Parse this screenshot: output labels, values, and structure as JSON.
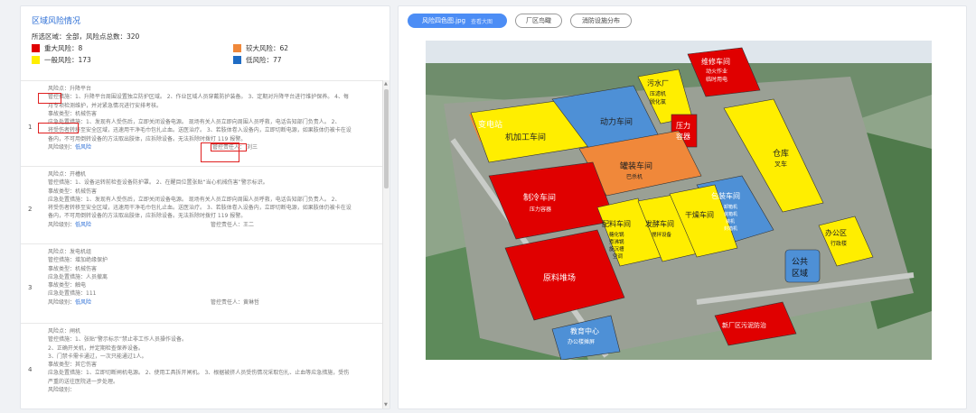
{
  "left_panel": {
    "title": "区域风险情况",
    "summary": "所选区域：全部，风险点总数：320",
    "legend": [
      {
        "label": "重大风险：8",
        "color": "#e00000"
      },
      {
        "label": "较大风险：62",
        "color": "#f0883a"
      },
      {
        "label": "一般风险：173",
        "color": "#ffee00"
      },
      {
        "label": "低风险：77",
        "color": "#1f6cc4"
      }
    ],
    "rows": [
      {
        "index": "1",
        "lines": [
          "风险点：升降平台",
          "管控措施：1、升降平台周围设置独立防护区域。 2、作业区域人员穿戴防护装备。 3、定期对升降平台进行维护保养。 4、每",
          "月专项检测维护，并对紧急情况进行安排考核。",
          "事故类型：机械伤害",
          "应急处置措施：1、发现有人受伤后，立即关闭设备电源。 现场有关人员立即向周围人员呼救，电话告知部门负责人。 2、",
          "将受伤者转移至安全区域，迅速用干净毛巾包扎止血。送医治疗。 3、若肢体卷入设备内，立即切断电源，如果肢体仍被卡在设",
          "备内，不可用倒转设备的方法取出肢体，应拆除设备。无法拆除时拨打 119 报警。"
        ],
        "level_label": "风险级别：",
        "level": "低风险",
        "owner_label": "管控责任人：",
        "owner": "刘三"
      },
      {
        "index": "2",
        "lines": [
          "风险点：开槽机",
          "管控措施：1、设备运转前检查设备防护罩。 2、在醒目位置张贴“当心机械伤害”警示标识。",
          "事故类型：机械伤害",
          "应急处置措施：1、发现有人受伤后，立即关闭设备电源。 现场有关人员立即向周围人员呼救，电话告知部门负责人。 2、",
          "将受伤者转移至安全区域，迅速用干净毛巾包扎止血。送医治疗。 3、若肢体卷入设备内，立即切断电源，如果肢体仍被卡在设",
          "备内，不可用倒转设备的方法取出肢体，应拆除设备。无法拆除时拨打 119 报警。"
        ],
        "level_label": "风险级别：",
        "level": "低风险",
        "owner_label": "管控责任人：",
        "owner": "王二"
      },
      {
        "index": "3",
        "lines": [
          "风险点：发电机组",
          "管控措施：增加绝缘保护",
          "事故类型：机械伤害",
          "应急处置措施：人员撤离",
          "事故类型：触电",
          "应急处置措施：111"
        ],
        "level_label": "风险级别：",
        "level": "低风险",
        "owner_label": "管控责任人：",
        "owner": "黄琳哲"
      },
      {
        "index": "4",
        "lines": [
          "风险点：闸机",
          "管控措施：1、张贴“警示标示”禁止非工作人员操作设备。",
          "2、正确开关机，并定期检查保养设备。",
          "3、门禁卡需卡通过，一次只能通过1人。",
          "事故类型：其它伤害",
          "应急处置措施：1、立即切断闸机电源。 2、使用工具拆开闸机。 3、根据被挤人员受伤情况采取包扎、止血等应急措施，受伤",
          "严重的送往医院进一步处理。"
        ],
        "level_label": "风险级别：",
        "level": "",
        "owner_label": "",
        "owner": ""
      }
    ]
  },
  "right_panel": {
    "tabs": [
      {
        "label": "风险四色图.jpg",
        "sub": "查看大图",
        "active": true
      },
      {
        "label": "厂区鸟瞰",
        "active": false
      },
      {
        "label": "消防设施分布",
        "active": false
      }
    ],
    "map_labels": {
      "substation": "变电站",
      "machining": "机加工车间",
      "power": "动力车间",
      "sewage": [
        "污水厂",
        "压滤机",
        "脱化氯"
      ],
      "repair": [
        "维修车间",
        "动火作业",
        "临时用电"
      ],
      "pressure": [
        "压力",
        "容器"
      ],
      "canning": [
        "罐装车间",
        "巴杀机"
      ],
      "warehouse": [
        "仓库",
        "叉车"
      ],
      "cooling": [
        "制冷车间",
        "压力容器"
      ],
      "packing": [
        "包装车间",
        "卸箱机",
        "装箱机",
        "装机",
        "封箱机"
      ],
      "batching": [
        "配料车间",
        "糖化锅",
        "煮沸锅",
        "旋沉槽",
        "空调"
      ],
      "ferment": [
        "发酵车间",
        "搅拌设备"
      ],
      "dry": "干燥车间",
      "raw": "原料堆场",
      "office": [
        "办公区",
        "行政楼"
      ],
      "public": [
        "公共",
        "区域"
      ],
      "edu": [
        "教育中心",
        "办公楼摊屏"
      ],
      "newsite": "新厂区污泥防治"
    }
  },
  "colors": {
    "major": "#e00000",
    "large": "#f0883a",
    "general": "#ffee00",
    "low": "#1f6cc4",
    "accent": "#4c8df5"
  }
}
